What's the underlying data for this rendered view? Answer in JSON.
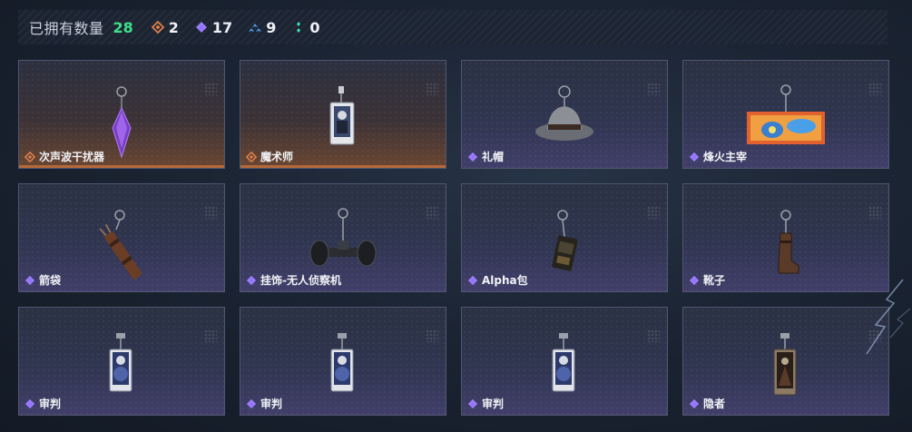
{
  "header": {
    "owned_label": "已拥有数量",
    "owned_count": "28",
    "rarity_counts": [
      {
        "rarity": "orange",
        "icon": "orange-diamond-icon",
        "value": "2",
        "color": "#e0804a"
      },
      {
        "rarity": "purple",
        "icon": "purple-diamond-icon",
        "value": "17",
        "color": "#9b7bff"
      },
      {
        "rarity": "blue",
        "icon": "blue-chevron-icon",
        "value": "9",
        "color": "#4d9bf0"
      },
      {
        "rarity": "green",
        "icon": "green-dots-icon",
        "value": "0",
        "color": "#3fe0b0"
      }
    ]
  },
  "items": [
    {
      "name": "次声波干扰器",
      "rarity": "orange",
      "icon": "crystal-pendant-icon"
    },
    {
      "name": "魔术师",
      "rarity": "orange",
      "icon": "card-keychain-icon"
    },
    {
      "name": "礼帽",
      "rarity": "purple",
      "icon": "hat-keychain-icon"
    },
    {
      "name": "烽火主宰",
      "rarity": "purple",
      "icon": "banner-keychain-icon"
    },
    {
      "name": "箭袋",
      "rarity": "purple",
      "icon": "quiver-keychain-icon"
    },
    {
      "name": "挂饰-无人侦察机",
      "rarity": "purple",
      "icon": "drone-keychain-icon"
    },
    {
      "name": "Alpha包",
      "rarity": "purple",
      "icon": "bag-keychain-icon"
    },
    {
      "name": "靴子",
      "rarity": "purple",
      "icon": "boot-keychain-icon"
    },
    {
      "name": "审判",
      "rarity": "purple",
      "icon": "judgement-card-icon"
    },
    {
      "name": "审判",
      "rarity": "purple",
      "icon": "judgement-card-icon"
    },
    {
      "name": "审判",
      "rarity": "purple",
      "icon": "judgement-card-icon"
    },
    {
      "name": "隐者",
      "rarity": "purple",
      "icon": "hermit-card-icon"
    }
  ],
  "colors": {
    "orange_rarity": "#e0804a",
    "purple_rarity": "#9b7bff",
    "owned_count": "#3fe08a"
  }
}
